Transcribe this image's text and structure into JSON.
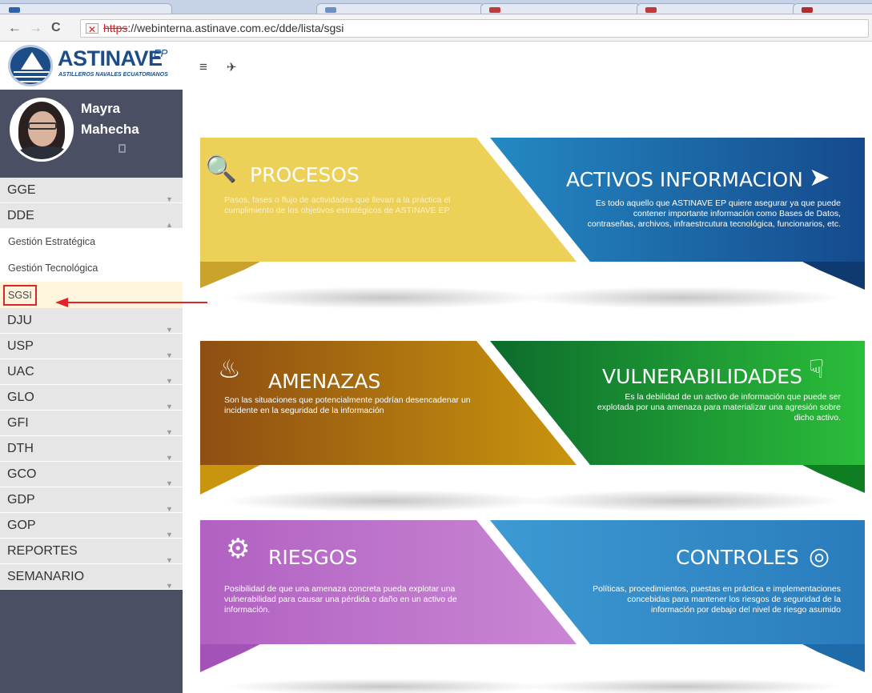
{
  "browser": {
    "url_scheme": "https",
    "url_rest": "://webinterna.astinave.com.ec/dde/lista/sgsi",
    "back_icon": "arrow-left-icon",
    "forward_icon": "arrow-right-icon",
    "reload_icon": "reload-icon"
  },
  "logo": {
    "name": "ASTINAVE",
    "suffix": "EP",
    "subtitle": "ASTILLEROS NAVALES ECUATORIANOS"
  },
  "user": {
    "first_name": "Mayra",
    "last_name": "Mahecha"
  },
  "sidebar": {
    "groups": [
      {
        "label": "GGE",
        "expanded": false
      },
      {
        "label": "DDE",
        "expanded": true,
        "children": [
          "Gestión Estratégica",
          "Gestión Tecnológica",
          "SGSI"
        ],
        "active_child": "SGSI"
      },
      {
        "label": "DJU",
        "expanded": false
      },
      {
        "label": "USP",
        "expanded": false
      },
      {
        "label": "UAC",
        "expanded": false
      },
      {
        "label": "GLO",
        "expanded": false
      },
      {
        "label": "GFI",
        "expanded": false
      },
      {
        "label": "DTH",
        "expanded": false
      },
      {
        "label": "GCO",
        "expanded": false
      },
      {
        "label": "GDP",
        "expanded": false
      },
      {
        "label": "GOP",
        "expanded": false
      },
      {
        "label": "REPORTES",
        "expanded": false
      },
      {
        "label": "SEMANARIO",
        "expanded": false
      }
    ]
  },
  "toolbar": {
    "menu_icon": "hamburger-icon",
    "plane_icon": "airplane-icon"
  },
  "tiles": [
    {
      "title": "PROCESOS",
      "icon": "search-globe-icon",
      "color": "#e9c94b",
      "description": "Pasos, fases o flujo de actividades que llevan a la práctica el cumplimiento de los objetivos estratégicos de ASTINAVE EP"
    },
    {
      "title": "ACTIVOS INFORMACION",
      "icon": "paper-plane-icon",
      "color": "#1b5fa2",
      "description": "Es todo aquello que ASTINAVE EP quiere asegurar ya que puede contener importante información como Bases de Datos, contraseñas, archivos, infraestrcutura tecnológica, funcionarios, etc."
    },
    {
      "title": "AMENAZAS",
      "icon": "fire-icon",
      "color": "#b0700e",
      "description": "Son las situaciones que potencialmente podrían desencadenar  un incidente en la seguridad de la información"
    },
    {
      "title": "VULNERABILIDADES",
      "icon": "thumbs-down-icon",
      "color": "#1a9b2e",
      "description": "Es la debilidad de un activo de información que puede ser explotada por una amenaza para materializar una agresión sobre dicho activo."
    },
    {
      "title": "RIESGOS",
      "icon": "gears-icon",
      "color": "#b564c4",
      "description": "Posibilidad de que una amenaza concreta pueda explotar una vulnerabilidad para causar una pérdida o daño en un activo de información."
    },
    {
      "title": "CONTROLES",
      "icon": "eye-icon",
      "color": "#2f8ac9",
      "description": "Políticas, procedimientos, puestas en práctica e implementaciones concebidas para mantener los riesgos de seguridad de la información por debajo del nivel de riesgo asumido"
    }
  ]
}
